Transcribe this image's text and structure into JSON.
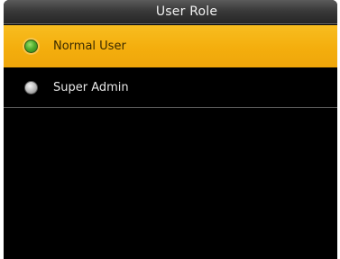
{
  "window": {
    "title": "User Role"
  },
  "options": [
    {
      "label": "Normal User",
      "selected": true
    },
    {
      "label": "Super Admin",
      "selected": false
    }
  ],
  "colors": {
    "selected_row": "#f4ae0d",
    "background": "#000000",
    "radio_selected": "#4fae2f",
    "radio_unselected": "#bdbdbd"
  }
}
